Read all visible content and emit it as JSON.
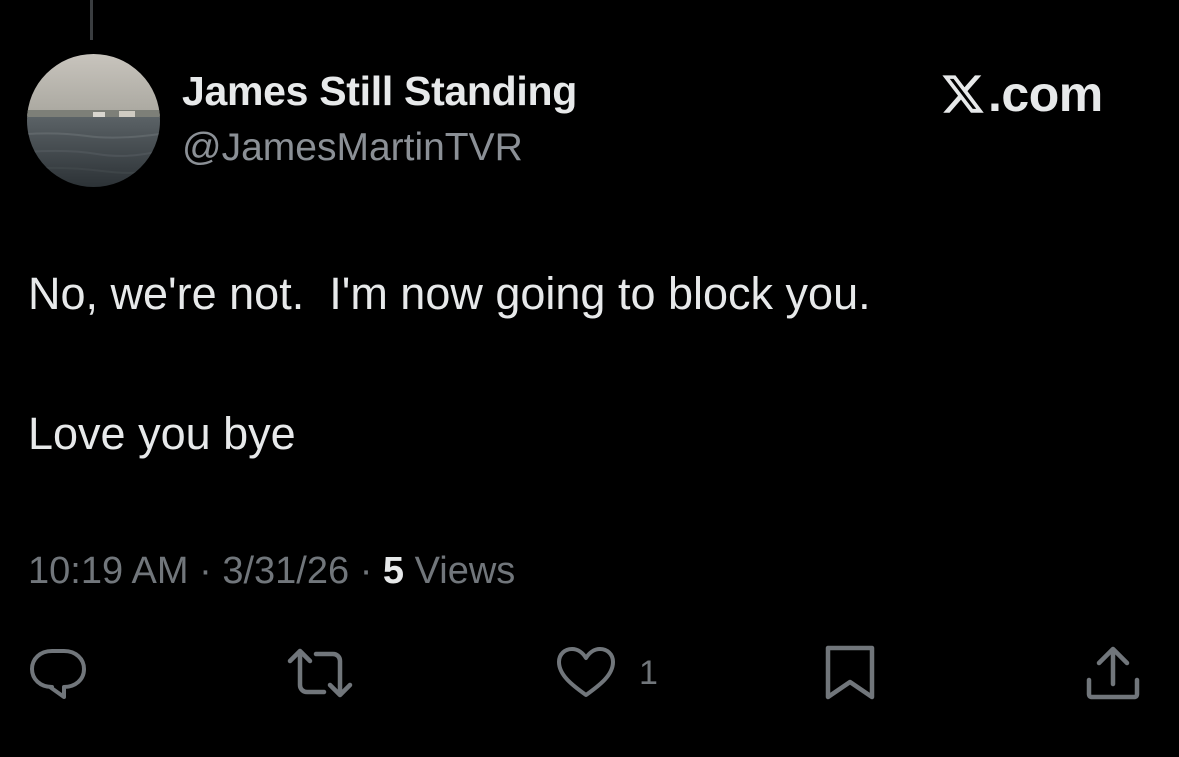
{
  "tweet": {
    "display_name": "James Still Standing",
    "handle": "@JamesMartinTVR",
    "line_1": "No, we're not.  I'm now going to block you.",
    "line_2": "Love you bye",
    "time": "10:19 AM",
    "date": "3/31/26",
    "views_count": "5",
    "views_label": "Views"
  },
  "brand": {
    "text": ".com",
    "icon": "x-logo-icon"
  },
  "actions": {
    "reply_icon": "reply-icon",
    "retweet_icon": "retweet-icon",
    "like_icon": "heart-icon",
    "like_count": "1",
    "bookmark_icon": "bookmark-icon",
    "share_icon": "share-icon"
  },
  "colors": {
    "background": "#000000",
    "primary_text": "#e7e9ea",
    "secondary_text": "#71767b"
  }
}
